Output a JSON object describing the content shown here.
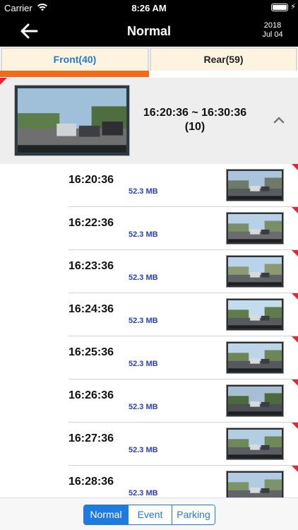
{
  "status": {
    "carrier": "Carrier",
    "time": "8:26 AM",
    "battery_icon": "battery-full-icon",
    "wifi_icon": "wifi-icon"
  },
  "nav": {
    "title": "Normal",
    "year": "2018",
    "day": "Jul 04",
    "back_icon": "back-arrow-icon"
  },
  "tabs": [
    {
      "label": "Front(40)",
      "active": true
    },
    {
      "label": "Rear(59)",
      "active": false
    }
  ],
  "group": {
    "range": "16:20:36 ~ 16:30:36",
    "count": "(10)",
    "chevron_icon": "chevron-up-icon"
  },
  "recordings": [
    {
      "time": "16:20:36",
      "size": "52.3 MB"
    },
    {
      "time": "16:22:36",
      "size": "52.3 MB"
    },
    {
      "time": "16:23:36",
      "size": "52.3 MB"
    },
    {
      "time": "16:24:36",
      "size": "52.3 MB"
    },
    {
      "time": "16:25:36",
      "size": "52.3 MB"
    },
    {
      "time": "16:26:36",
      "size": "52.3 MB"
    },
    {
      "time": "16:27:36",
      "size": "52.3 MB"
    },
    {
      "time": "16:28:36",
      "size": "52.3 MB"
    }
  ],
  "segments": [
    {
      "label": "Normal",
      "active": true
    },
    {
      "label": "Event",
      "active": false
    },
    {
      "label": "Parking",
      "active": false
    }
  ],
  "colors": {
    "accent": "#1f7be0",
    "tab_active_underline": "#f26a1b",
    "flag": "#e8242f",
    "size_text": "#2c3fc0"
  }
}
